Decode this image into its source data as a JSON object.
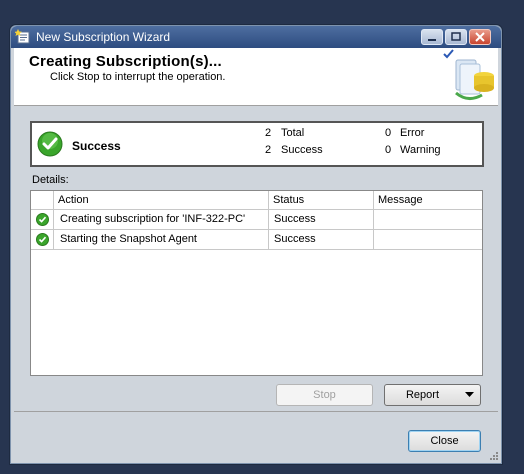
{
  "window": {
    "title": "New Subscription Wizard"
  },
  "header": {
    "title": "Creating Subscription(s)...",
    "subtitle": "Click Stop to interrupt the operation."
  },
  "summary": {
    "status": "Success",
    "total_count": "2",
    "total_label": "Total",
    "success_count": "2",
    "success_label": "Success",
    "error_count": "0",
    "error_label": "Error",
    "warning_count": "0",
    "warning_label": "Warning"
  },
  "details": {
    "label": "Details:",
    "columns": {
      "action": "Action",
      "status": "Status",
      "message": "Message"
    },
    "rows": [
      {
        "action": "Creating subscription for 'INF-322-PC'",
        "status": "Success",
        "message": ""
      },
      {
        "action": "Starting the Snapshot Agent",
        "status": "Success",
        "message": ""
      }
    ]
  },
  "buttons": {
    "stop": "Stop",
    "report": "Report",
    "close": "Close"
  },
  "colors": {
    "success_green": "#3aa52b",
    "title_bar": "#2d4c80"
  }
}
